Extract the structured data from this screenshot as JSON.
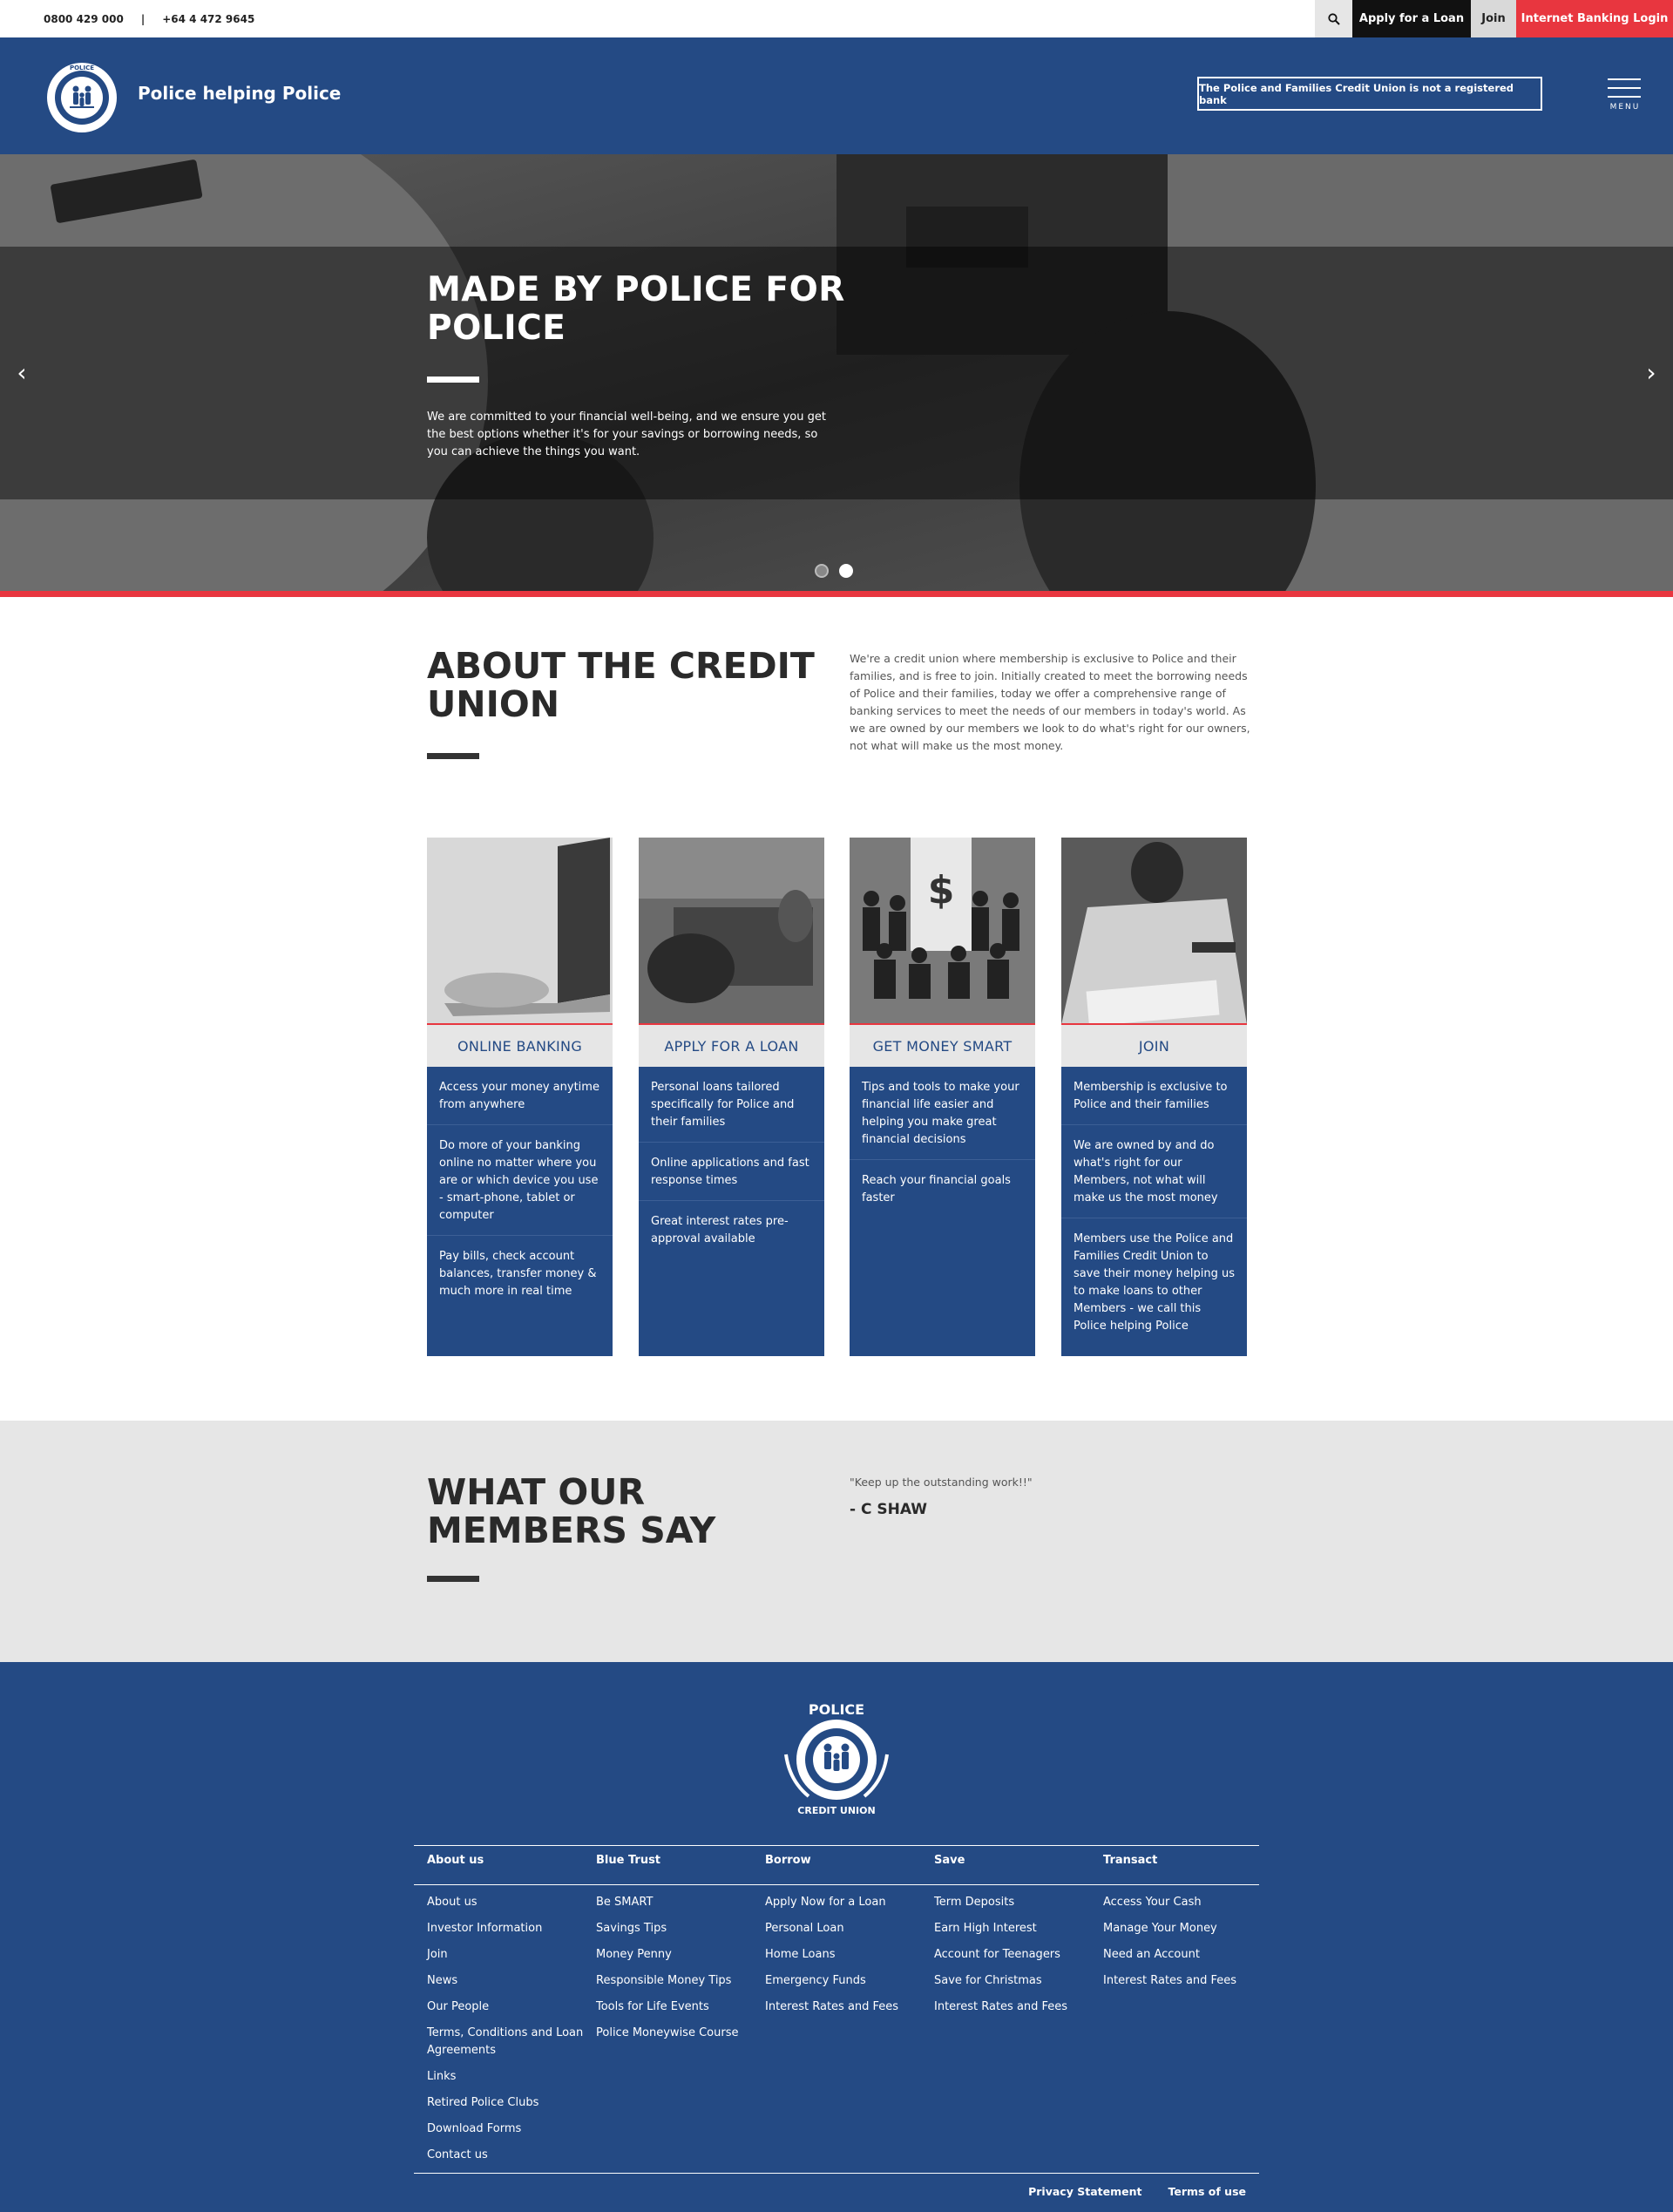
{
  "topbar": {
    "phone1": "0800 429 000",
    "separator": "|",
    "phone2": "+64 4 472 9645",
    "search_icon": "search-icon",
    "apply_label": "Apply for a Loan",
    "join_label": "Join",
    "internet_banking_label": "Internet Banking Login"
  },
  "header": {
    "logo_text": "POLICE CREDIT UNION",
    "brand": "Police helping Police",
    "notice": "The Police and Families Credit Union is not a registered bank",
    "menu_label": "MENU"
  },
  "hero": {
    "title": "MADE BY POLICE FOR POLICE",
    "text": "We are committed to your financial well-being, and we ensure you get the best options whether it's for your savings or borrowing needs, so you can achieve the things you want.",
    "prev_icon": "‹",
    "next_icon": "›",
    "slide_count": 2,
    "active_slide": 2
  },
  "about": {
    "title": "ABOUT THE CREDIT UNION",
    "text": "We're a credit union where membership is exclusive to Police and their families, and is free to join. Initially created to meet the borrowing needs of Police and their families, today we offer a comprehensive range of banking services to meet the needs of our members in today's world. As we are owned by our members we look to do what's right for our owners, not what will make us the most money."
  },
  "cards": [
    {
      "title": "ONLINE BANKING",
      "items": [
        "Access your money anytime from anywhere",
        "Do more of your banking online no matter where you are or which device you use - smart-phone, tablet or computer",
        "Pay bills, check account balances, transfer money & much more in real time"
      ]
    },
    {
      "title": "APPLY FOR A LOAN",
      "items": [
        "Personal loans tailored specifically for Police and their families",
        "Online applications and fast response times",
        "Great interest rates pre-approval available"
      ]
    },
    {
      "title": "GET MONEY SMART",
      "items": [
        "Tips and tools to make your financial life easier and helping you make great financial decisions",
        "Reach your financial goals faster"
      ]
    },
    {
      "title": "JOIN",
      "items": [
        "Membership is exclusive to Police and their families",
        "We are owned by and do what's right for our Members, not what will make us the most money",
        "Members use the Police and Families Credit Union to save their money helping us to make loans to other Members - we call this Police helping Police"
      ]
    }
  ],
  "testimonials": {
    "title": "WHAT OUR MEMBERS SAY",
    "quote": "\"Keep up the outstanding work!!\"",
    "author": "- C SHAW"
  },
  "footer": {
    "logo_text": "POLICE AND FAMILIES CREDIT UNION",
    "columns": [
      {
        "heading": "About us",
        "links": [
          "About us",
          "Investor Information",
          "Join",
          "News",
          "Our People",
          "Terms, Conditions and Loan Agreements",
          "Links",
          "Retired Police Clubs",
          "Download Forms",
          "Contact us"
        ]
      },
      {
        "heading": "Blue Trust",
        "links": [
          "Be SMART",
          "Savings Tips",
          "Money Penny",
          "Responsible Money Tips",
          "Tools for Life Events",
          "Police Moneywise Course"
        ]
      },
      {
        "heading": "Borrow",
        "links": [
          "Apply Now for a Loan",
          "Personal Loan",
          "Home Loans",
          "Emergency Funds",
          "Interest Rates and Fees"
        ]
      },
      {
        "heading": "Save",
        "links": [
          "Term Deposits",
          "Earn High Interest",
          "Account for Teenagers",
          "Save for Christmas",
          "Interest Rates and Fees"
        ]
      },
      {
        "heading": "Transact",
        "links": [
          "Access Your Cash",
          "Manage Your Money",
          "Need an Account",
          "Interest Rates and Fees"
        ]
      }
    ],
    "privacy": "Privacy Statement",
    "terms": "Terms of use"
  },
  "colors": {
    "brand_blue": "#244a84",
    "accent_red": "#e8363f",
    "light_grey": "#e6e6e6"
  }
}
